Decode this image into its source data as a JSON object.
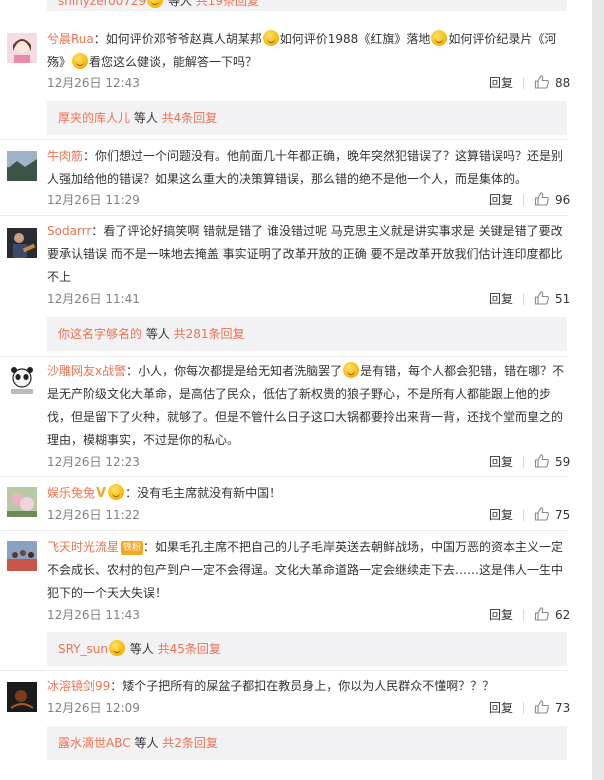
{
  "top_partial": {
    "user": "shinyzero0729",
    "suffix": " 等人",
    "count_text": " 共19条回复"
  },
  "comments": [
    {
      "avatar": "avatar-girl-pink",
      "user": "兮晨Rua",
      "text_segments": [
        "：如何评价邓爷爷赵真人胡某邦",
        "如何评价1988《红旗》落地",
        "如何评价纪录片《河殇》",
        "看您这么健谈，能解答一下吗？"
      ],
      "time": "12月26日 12:43",
      "reply_label": "回复",
      "likes": "88",
      "replies": {
        "user": "厚夹的库人儿",
        "middle": " 等人 ",
        "count_text": "共4条回复"
      }
    },
    {
      "avatar": "avatar-landscape",
      "user": "牛肉筋",
      "text": "：你们想过一个问题没有。他前面几十年都正确，晚年突然犯错误了？这算错误吗？还是别人强加给他的错误？如果这么重大的决策算错误，那么错的绝不是他一个人，而是集体的。",
      "time": "12月26日 11:29",
      "reply_label": "回复",
      "likes": "96"
    },
    {
      "avatar": "avatar-guitar",
      "user": "Sodarrr",
      "text": "：看了评论好搞笑啊  错就是错了  谁没错过呢   马克思主义就是讲实事求是  关键是错了要改  要承认错误  而不是一味地去掩盖  事实证明了改革开放的正确  要不是改革开放我们估计连印度都比不上",
      "time": "12月26日 11:41",
      "reply_label": "回复",
      "likes": "51",
      "replies": {
        "user": "你这名字够名的",
        "middle": " 等人 ",
        "count_text": "共281条回复"
      }
    },
    {
      "avatar": "avatar-panda",
      "user": "沙雕网友x战警",
      "text_segments": [
        "：小人，你每次都提是给无知者洗脑罢了",
        "是有错，每个人都会犯错，错在哪？不是无产阶级文化大革命，是高估了民众，低估了新权贵的狼子野心，不是所有人都能跟上他的步伐，但是留下了火种，就够了。但是不管什么日子这口大锅都要拎出来背一背，还找个堂而皇之的理由，模糊事实，不过是你的私心。"
      ],
      "time": "12月26日 12:23",
      "reply_label": "回复",
      "likes": "59"
    },
    {
      "avatar": "avatar-flower",
      "user": "娱乐兔兔",
      "text": "：没有毛主席就没有新中国！",
      "time": "12月26日 11:22",
      "reply_label": "回复",
      "likes": "75"
    },
    {
      "avatar": "avatar-crowd",
      "user": "飞天时光流星",
      "badge": "铁粉",
      "text": "：如果毛孔主席不把自己的儿子毛岸英送去朝鲜战场，中国万恶的资本主义一定不会成长、农村的包产到户一定不会得逞。文化大革命道路一定会继续走下去……这是伟人一生中犯下的一个天大失误！",
      "time": "12月26日 11:43",
      "reply_label": "回复",
      "likes": "62",
      "replies": {
        "user": "SRY_sun",
        "middle": " 等人 ",
        "count_text": "共45条回复"
      }
    },
    {
      "avatar": "avatar-dark",
      "user": "冰溶镜剑99",
      "text": "：矮个子把所有的屎盆子都扣在教员身上，你以为人民群众不懂啊？？？",
      "time": "12月26日 12:09",
      "reply_label": "回复",
      "likes": "73",
      "replies": {
        "user": "露水滴世ABC",
        "middle": " 等人 ",
        "count_text": "共2条回复"
      }
    }
  ]
}
